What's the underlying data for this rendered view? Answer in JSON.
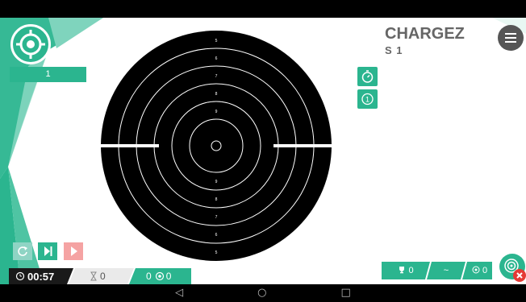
{
  "header": {
    "mode_title": "CHARGEZ",
    "series_label": "S 1"
  },
  "shot_tab": {
    "label": "1"
  },
  "target": {
    "ring_labels_top": [
      "5",
      "6",
      "7",
      "8",
      "9"
    ],
    "ring_labels_bottom": [
      "9",
      "8",
      "7",
      "6",
      "5"
    ]
  },
  "footer": {
    "timer": "00:57",
    "hourglass_count": "0",
    "reticle_count": "0",
    "trophy_count": "0",
    "tilde": "~",
    "target_count": "0"
  },
  "nav": {
    "back": "◁",
    "home": "○",
    "recents": "□"
  },
  "colors": {
    "accent": "#2bb58f",
    "accent_light": "#7fd4bd",
    "danger": "#e53935",
    "control_pink": "#f5a3a3",
    "control_light": "#8fd4c4",
    "dark": "#1a1a1a"
  },
  "icons": {
    "logo": "target-logo-icon",
    "menu": "hamburger-menu-icon",
    "stopwatch": "stopwatch-icon",
    "number_one": "number-one-icon",
    "refresh": "refresh-icon",
    "skip_next": "skip-next-icon",
    "play": "play-icon",
    "clock": "clock-icon",
    "hourglass": "hourglass-icon",
    "reticle": "reticle-icon",
    "trophy": "trophy-icon",
    "close": "close-icon"
  }
}
